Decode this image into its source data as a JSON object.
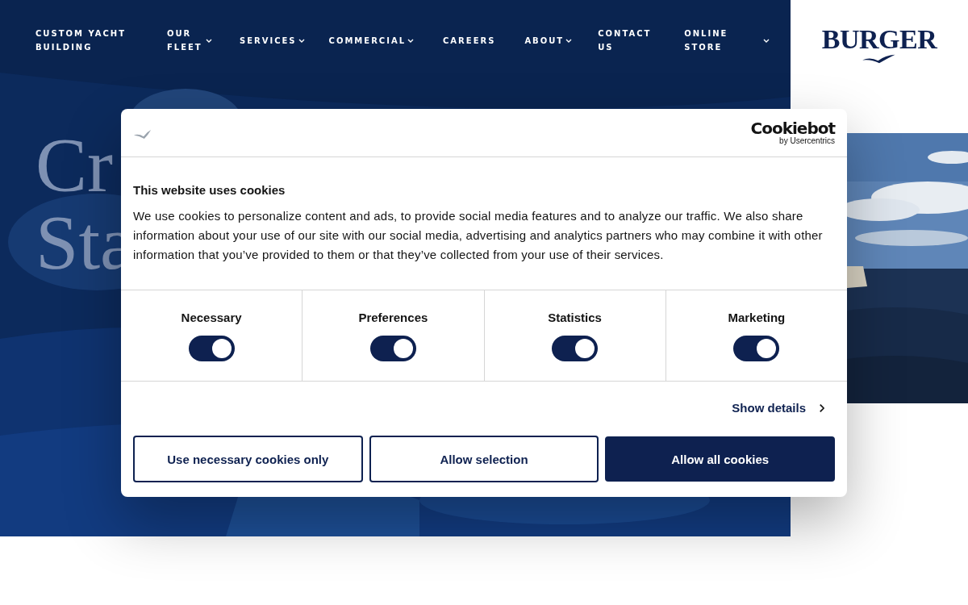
{
  "nav": [
    {
      "label": "CUSTOM YACHT BUILDING",
      "dropdown": false
    },
    {
      "label": "OUR FLEET",
      "dropdown": true
    },
    {
      "label": "SERVICES",
      "dropdown": true
    },
    {
      "label": "COMMERCIAL",
      "dropdown": true
    },
    {
      "label": "CAREERS",
      "dropdown": false
    },
    {
      "label": "ABOUT",
      "dropdown": true
    },
    {
      "label": "CONTACT US",
      "dropdown": false
    },
    {
      "label": "ONLINE STORE",
      "dropdown": true
    }
  ],
  "logo": "BURGER",
  "hero": {
    "lines": [
      "Cr",
      "Sta"
    ]
  },
  "cookie_dialog": {
    "brand": "Cookiebot",
    "brand_sub": "by Usercentrics",
    "title": "This website uses cookies",
    "text": "We use cookies to personalize content and ads, to provide social media features and to analyze our traffic. We also share information about your use of our site with our social media, advertising and analytics partners who may combine it with other information that you’ve provided to them or that they’ve collected from your use of their services.",
    "toggles": [
      {
        "label": "Necessary",
        "checked": true
      },
      {
        "label": "Preferences",
        "checked": true
      },
      {
        "label": "Statistics",
        "checked": true
      },
      {
        "label": "Marketing",
        "checked": true
      }
    ],
    "details_link": "Show details",
    "buttons": [
      {
        "label": "Use necessary cookies only",
        "kind": "outline"
      },
      {
        "label": "Allow selection",
        "kind": "outline"
      },
      {
        "label": "Allow all cookies",
        "kind": "primary"
      }
    ]
  }
}
